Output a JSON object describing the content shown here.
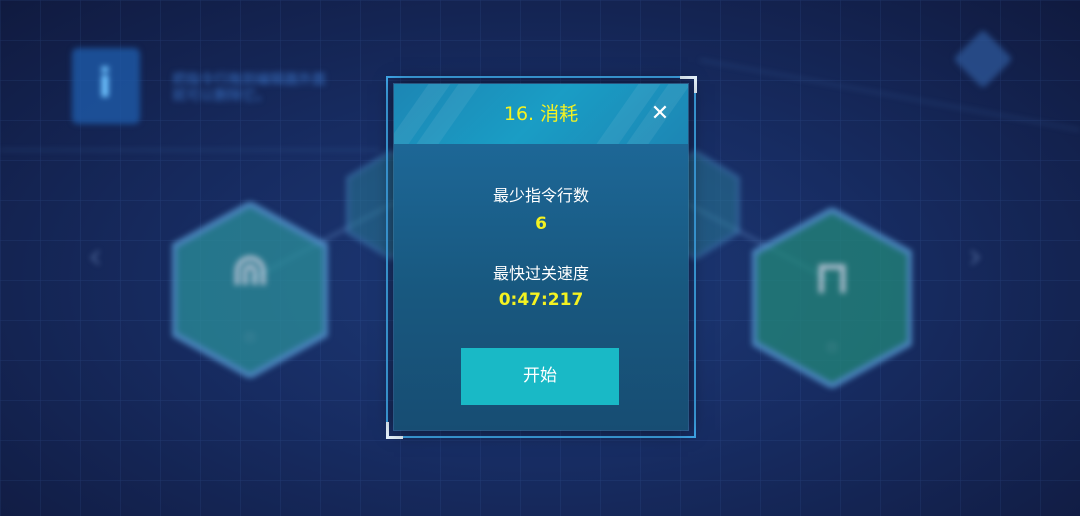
{
  "background": {
    "hint_text_line1": "把指令行拖到编辑器外面",
    "hint_text_line2": "就可以删除它。",
    "hint_icon": "info-icon"
  },
  "dialog": {
    "title": "16. 消耗",
    "close_icon": "close-icon",
    "min_lines_label": "最少指令行数",
    "min_lines_value": "6",
    "best_time_label": "最快过关速度",
    "best_time_value": "0:47:217",
    "start_label": "开始"
  },
  "colors": {
    "accent_yellow": "#f4f221",
    "button_cyan": "#19b9c6",
    "frame_blue": "#3fa7ea",
    "dialog_body": "#18587f"
  }
}
